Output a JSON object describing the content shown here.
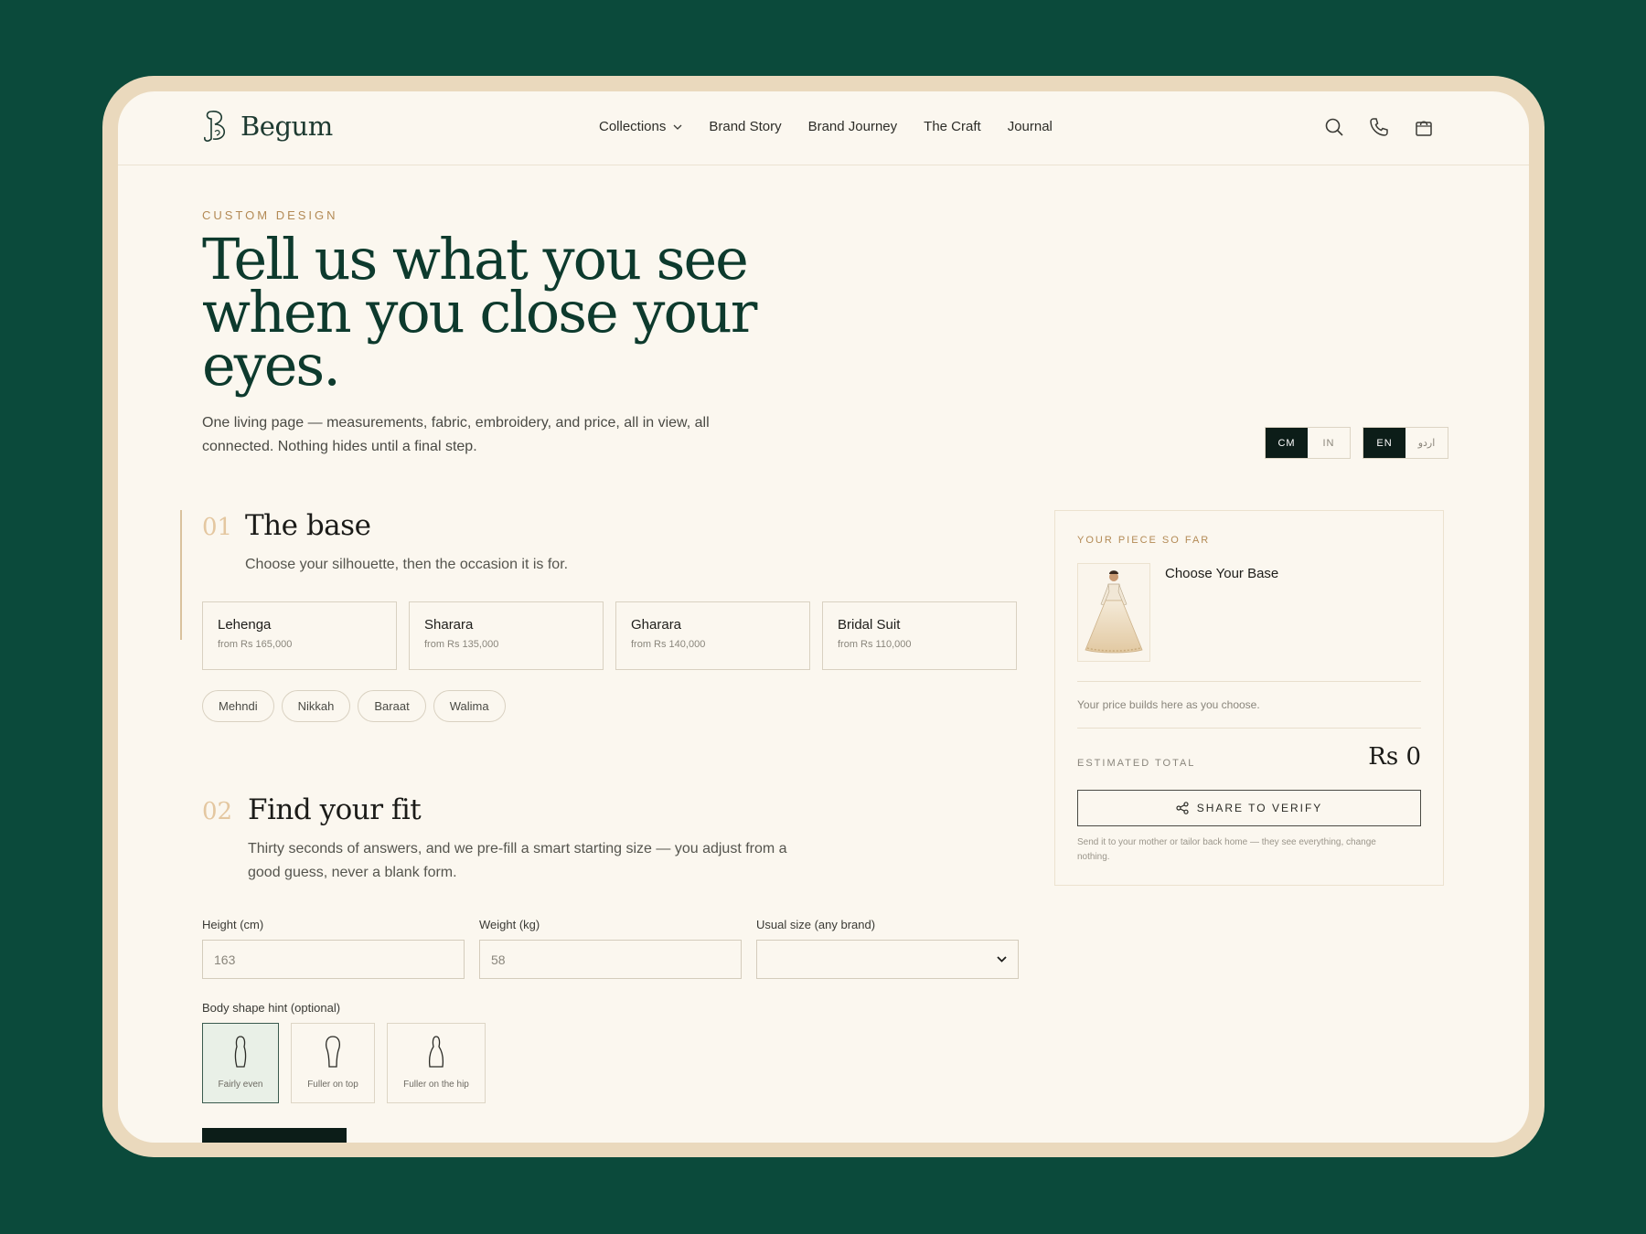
{
  "brand": {
    "name": "Begum"
  },
  "nav": {
    "items": [
      {
        "label": "Collections",
        "has_dropdown": true
      },
      {
        "label": "Brand Story"
      },
      {
        "label": "Brand Journey"
      },
      {
        "label": "The Craft"
      },
      {
        "label": "Journal"
      }
    ],
    "icons": [
      "search-icon",
      "phone-icon",
      "cart-icon"
    ]
  },
  "hero": {
    "eyebrow": "CUSTOM DESIGN",
    "title": "Tell us what you see when you close your eyes.",
    "subtitle": "One living page — measurements, fabric, embroidery, and price, all in view, all connected. Nothing hides until a final step."
  },
  "toggles": {
    "units": [
      {
        "label": "CM",
        "active": true
      },
      {
        "label": "IN",
        "active": false
      }
    ],
    "languages": [
      {
        "label": "EN",
        "active": true
      },
      {
        "label": "اردو",
        "active": false
      }
    ]
  },
  "section1": {
    "number": "01",
    "title": "The base",
    "subtitle": "Choose your silhouette, then the occasion it is for.",
    "bases": [
      {
        "name": "Lehenga",
        "price": "from Rs 165,000"
      },
      {
        "name": "Sharara",
        "price": "from Rs 135,000"
      },
      {
        "name": "Gharara",
        "price": "from Rs 140,000"
      },
      {
        "name": "Bridal Suit",
        "price": "from Rs 110,000"
      }
    ],
    "occasions": [
      "Mehndi",
      "Nikkah",
      "Baraat",
      "Walima"
    ]
  },
  "section2": {
    "number": "02",
    "title": "Find your fit",
    "subtitle": "Thirty seconds of answers, and we pre-fill a smart starting size — you adjust from a good guess, never a blank form.",
    "height": {
      "label": "Height (cm)",
      "value": "163"
    },
    "weight": {
      "label": "Weight (kg)",
      "value": "58"
    },
    "usual_size": {
      "label": "Usual size (any brand)",
      "value": ""
    },
    "shape_label": "Body shape hint (optional)",
    "shapes": [
      {
        "label": "Fairly even",
        "active": true
      },
      {
        "label": "Fuller on top",
        "active": false
      },
      {
        "label": "Fuller on the hip",
        "active": false
      }
    ]
  },
  "summary": {
    "eyebrow": "YOUR PIECE SO FAR",
    "choose": "Choose Your Base",
    "price_note": "Your price builds here as you choose.",
    "total_label": "ESTIMATED TOTAL",
    "total": "Rs 0",
    "share_label": "SHARE TO VERIFY",
    "footnote": "Send it to your mother or tailor back home — they see everything, change nothing."
  },
  "colors": {
    "background": "#0b4a3b",
    "frame": "#ead9bd",
    "page": "#fbf7ef",
    "accent_gold": "#b38a55",
    "heading_green": "#0d3a2d",
    "active_dark": "#0c1d18"
  }
}
